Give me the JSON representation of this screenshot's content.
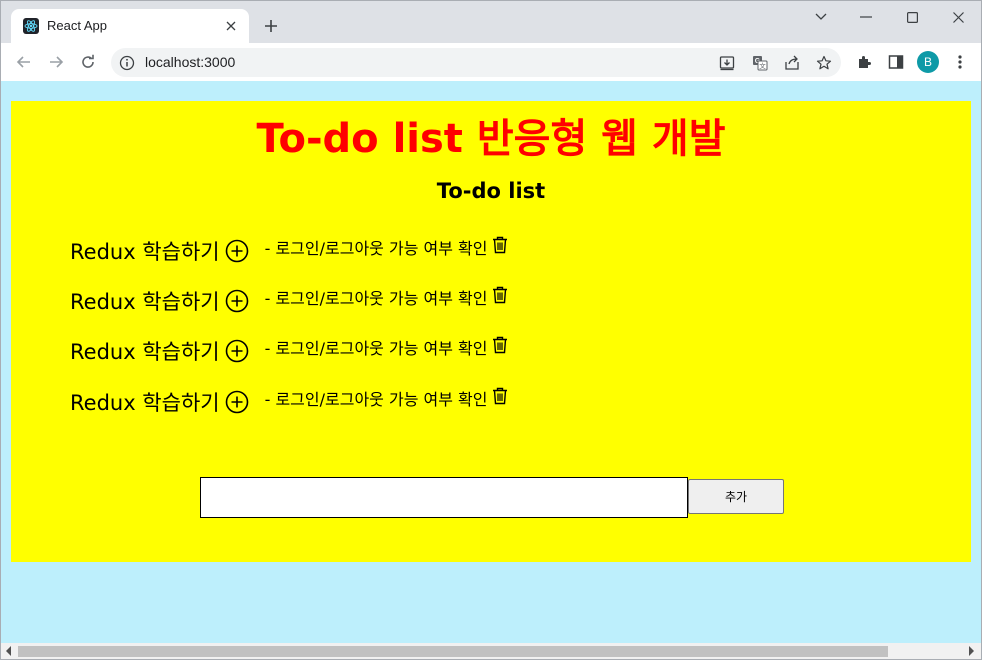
{
  "browser": {
    "tab_title": "React App",
    "url": "localhost:3000",
    "profile_initial": "B"
  },
  "app": {
    "title": "To-do list 반응형 웹 개발",
    "subtitle": "To-do list",
    "todos": [
      {
        "title": "Redux 학습하기",
        "desc": "- 로그인/로그아웃 가능 여부 확인"
      },
      {
        "title": "Redux 학습하기",
        "desc": "- 로그인/로그아웃 가능 여부 확인"
      },
      {
        "title": "Redux 학습하기",
        "desc": "- 로그인/로그아웃 가능 여부 확인"
      },
      {
        "title": "Redux 학습하기",
        "desc": "- 로그인/로그아웃 가능 여부 확인"
      }
    ],
    "input_value": "",
    "add_label": "추가"
  },
  "colors": {
    "page_bg": "#bdeffc",
    "app_bg": "#ffff00",
    "title": "#ff0000"
  },
  "icons": [
    "react-favicon",
    "close-icon",
    "plus-icon",
    "chevron-down-icon",
    "minimize-icon",
    "maximize-icon",
    "back-icon",
    "forward-icon",
    "reload-icon",
    "info-icon",
    "install-icon",
    "translate-icon",
    "share-icon",
    "star-icon",
    "extensions-icon",
    "side-panel-icon",
    "kebab-menu-icon",
    "add-circle-icon",
    "trash-icon"
  ]
}
